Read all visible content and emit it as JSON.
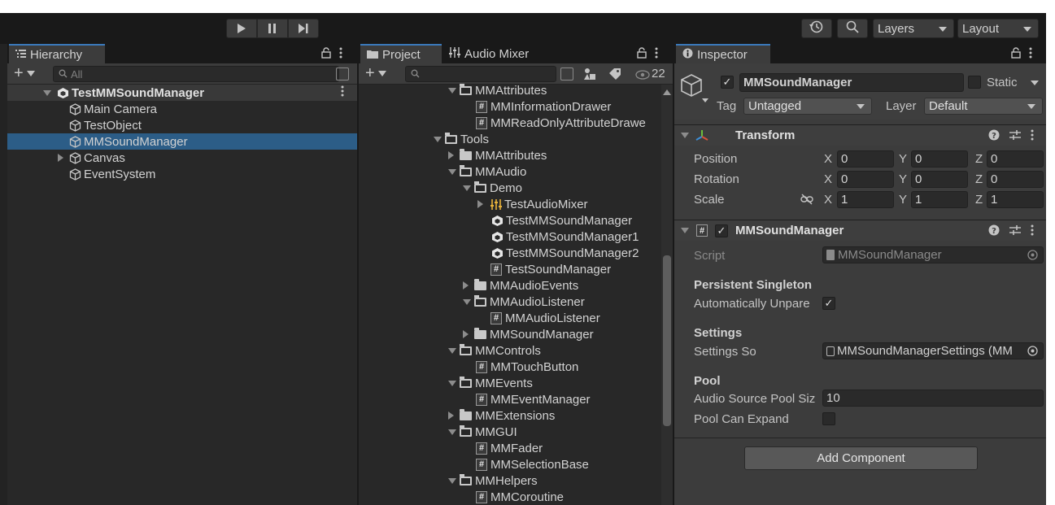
{
  "toolbar": {
    "play_icon": "play-icon",
    "pause_icon": "pause-icon",
    "step_icon": "step-icon",
    "history_icon": "history-icon",
    "search_icon": "search-icon",
    "layers_label": "Layers",
    "layout_label": "Layout"
  },
  "hierarchy": {
    "tab_label": "Hierarchy",
    "search_placeholder": "All",
    "scene": "TestMMSoundManager",
    "items": [
      {
        "label": "Main Camera",
        "selected": false,
        "expandable": false
      },
      {
        "label": "TestObject",
        "selected": false,
        "expandable": false
      },
      {
        "label": "MMSoundManager",
        "selected": true,
        "expandable": false
      },
      {
        "label": "Canvas",
        "selected": false,
        "expandable": true
      },
      {
        "label": "EventSystem",
        "selected": false,
        "expandable": false
      }
    ]
  },
  "project": {
    "tab_label": "Project",
    "audio_tab_label": "Audio Mixer",
    "visible_count": "22",
    "tree": [
      {
        "label": "MMAttributes",
        "type": "folder-open",
        "depth": 1,
        "expanded": true
      },
      {
        "label": "MMInformationDrawer",
        "type": "script",
        "depth": 2
      },
      {
        "label": "MMReadOnlyAttributeDrawe",
        "type": "script",
        "depth": 2
      },
      {
        "label": "Tools",
        "type": "folder-open",
        "depth": 0,
        "expanded": true
      },
      {
        "label": "MMAttributes",
        "type": "folder",
        "depth": 1,
        "expanded": false
      },
      {
        "label": "MMAudio",
        "type": "folder-open",
        "depth": 1,
        "expanded": true
      },
      {
        "label": "Demo",
        "type": "folder-open",
        "depth": 2,
        "expanded": true
      },
      {
        "label": "TestAudioMixer",
        "type": "mixer",
        "depth": 3,
        "expanded": false
      },
      {
        "label": "TestMMSoundManager",
        "type": "scene",
        "depth": 3
      },
      {
        "label": "TestMMSoundManager1",
        "type": "scene",
        "depth": 3
      },
      {
        "label": "TestMMSoundManager2",
        "type": "scene",
        "depth": 3
      },
      {
        "label": "TestSoundManager",
        "type": "script",
        "depth": 3
      },
      {
        "label": "MMAudioEvents",
        "type": "folder",
        "depth": 2,
        "expanded": false
      },
      {
        "label": "MMAudioListener",
        "type": "folder-open",
        "depth": 2,
        "expanded": true
      },
      {
        "label": "MMAudioListener",
        "type": "script",
        "depth": 3
      },
      {
        "label": "MMSoundManager",
        "type": "folder",
        "depth": 2,
        "expanded": false
      },
      {
        "label": "MMControls",
        "type": "folder-open",
        "depth": 1,
        "expanded": true
      },
      {
        "label": "MMTouchButton",
        "type": "script",
        "depth": 2
      },
      {
        "label": "MMEvents",
        "type": "folder-open",
        "depth": 1,
        "expanded": true
      },
      {
        "label": "MMEventManager",
        "type": "script",
        "depth": 2
      },
      {
        "label": "MMExtensions",
        "type": "folder",
        "depth": 1,
        "expanded": false
      },
      {
        "label": "MMGUI",
        "type": "folder-open",
        "depth": 1,
        "expanded": true
      },
      {
        "label": "MMFader",
        "type": "script",
        "depth": 2
      },
      {
        "label": "MMSelectionBase",
        "type": "script",
        "depth": 2
      },
      {
        "label": "MMHelpers",
        "type": "folder-open",
        "depth": 1,
        "expanded": true
      },
      {
        "label": "MMCoroutine",
        "type": "script",
        "depth": 2
      }
    ]
  },
  "inspector": {
    "tab_label": "Inspector",
    "object_name": "MMSoundManager",
    "static_label": "Static",
    "tag_label": "Tag",
    "tag_value": "Untagged",
    "layer_label": "Layer",
    "layer_value": "Default",
    "transform": {
      "title": "Transform",
      "position_label": "Position",
      "rotation_label": "Rotation",
      "scale_label": "Scale",
      "position": {
        "x": "0",
        "y": "0",
        "z": "0"
      },
      "rotation": {
        "x": "0",
        "y": "0",
        "z": "0"
      },
      "scale": {
        "x": "1",
        "y": "1",
        "z": "1"
      },
      "x_label": "X",
      "y_label": "Y",
      "z_label": "Z"
    },
    "component": {
      "title": "MMSoundManager",
      "script_label": "Script",
      "script_value": "MMSoundManager",
      "persistent_header": "Persistent Singleton",
      "auto_unparent_label": "Automatically Unpare",
      "settings_header": "Settings",
      "settings_so_label": "Settings So",
      "settings_so_value": "MMSoundManagerSettings (MM",
      "pool_header": "Pool",
      "pool_size_label": "Audio Source Pool Siz",
      "pool_size_value": "10",
      "pool_expand_label": "Pool Can Expand"
    },
    "add_component_label": "Add Component"
  },
  "colors": {
    "selection": "#2c5d87",
    "accent_tab": "#3a79bb",
    "panel_bg": "#282828"
  }
}
